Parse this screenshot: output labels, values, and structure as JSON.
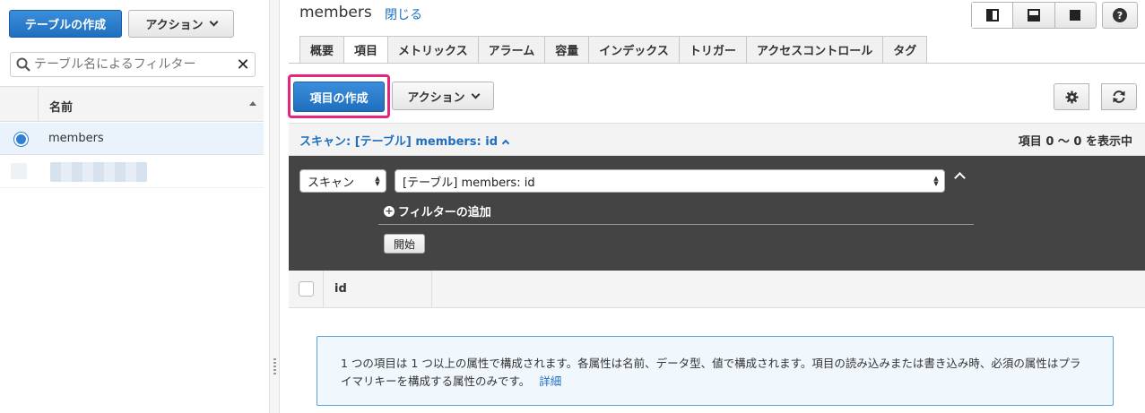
{
  "left_pane": {
    "create_table_label": "テーブルの作成",
    "actions_label": "アクション",
    "search_placeholder": "テーブル名によるフィルター",
    "column_name": "名前",
    "tables": [
      {
        "name": "members",
        "selected": true
      }
    ]
  },
  "header": {
    "title": "members",
    "close_label": "閉じる"
  },
  "tabs": [
    "概要",
    "項目",
    "メトリックス",
    "アラーム",
    "容量",
    "インデックス",
    "トリガー",
    "アクセスコントロール",
    "タグ"
  ],
  "active_tab": "項目",
  "toolbar": {
    "create_item_label": "項目の作成",
    "actions_label": "アクション"
  },
  "scan": {
    "summary": "スキャン: [テーブル] members: id",
    "count": "項目 0 〜 0 を表示中",
    "mode": "スキャン",
    "target": "[テーブル] members: id",
    "add_filter_label": "フィルターの追加",
    "start_label": "開始"
  },
  "results": {
    "columns": [
      "id"
    ]
  },
  "info": {
    "text": "1 つの項目は 1 つ以上の属性で構成されます。各属性は名前、データ型、値で構成されます。項目の読み込みまたは書き込み時、必須の属性はプライマリキーを構成する属性のみです。",
    "link": "詳細"
  },
  "colors": {
    "primary": "#1f6fbf",
    "highlight": "#e6267d",
    "dark_panel": "#444444",
    "info_border": "#5ea2d8"
  }
}
